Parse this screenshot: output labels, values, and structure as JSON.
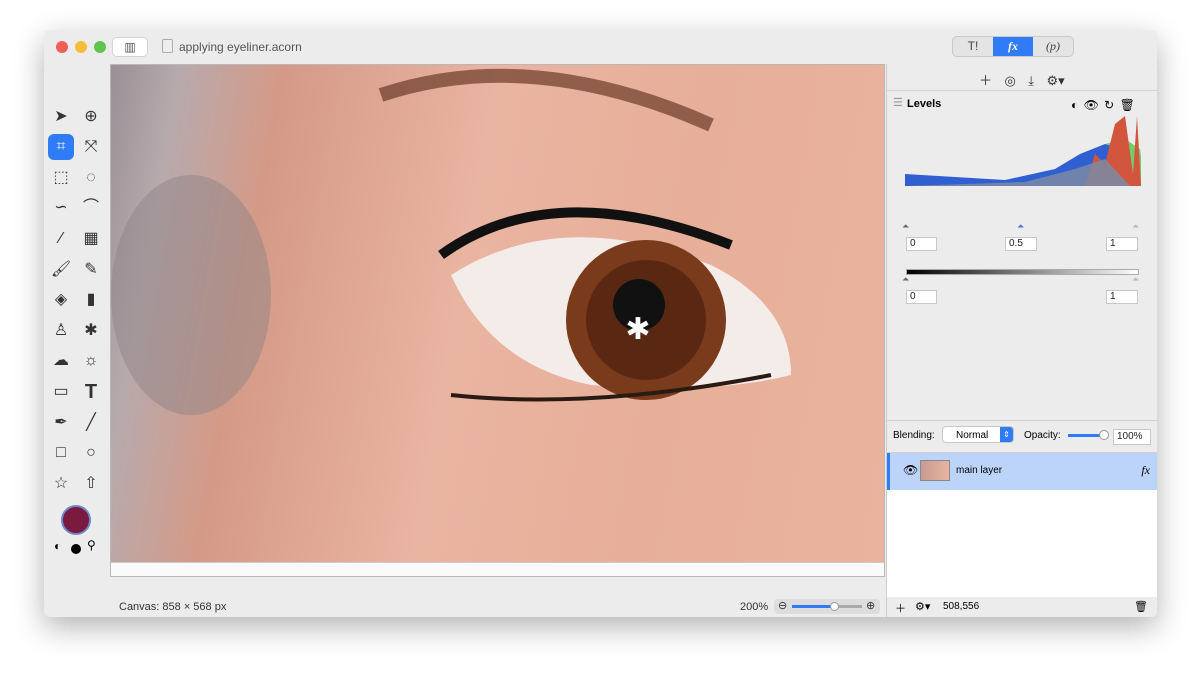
{
  "window": {
    "title": "applying eyeliner.acorn"
  },
  "inspector_tabs": [
    {
      "label": "T!",
      "icon": "tools-icon"
    },
    {
      "label": "fx",
      "active": true
    },
    {
      "label": "(p)"
    }
  ],
  "filters": {
    "title": "Levels",
    "input_levels": {
      "black": "0",
      "gamma": "0.5",
      "white": "1"
    },
    "output_levels": {
      "black": "0",
      "white": "1"
    }
  },
  "blending": {
    "label": "Blending:",
    "mode": "Normal",
    "opacity_label": "Opacity:",
    "opacity": "100%",
    "opacity_fraction": 1.0
  },
  "layers": [
    {
      "name": "main layer",
      "visible": true,
      "selected": true,
      "fx": "fx"
    }
  ],
  "status": {
    "canvas": "Canvas: 858 × 568 px",
    "zoom": "200%",
    "zoom_fraction": 0.6,
    "layer_stats": "508,556"
  },
  "colors": {
    "accent": "#2f7cf6",
    "foreground": "#7a1a3e",
    "selection": "#bcd4f9"
  }
}
